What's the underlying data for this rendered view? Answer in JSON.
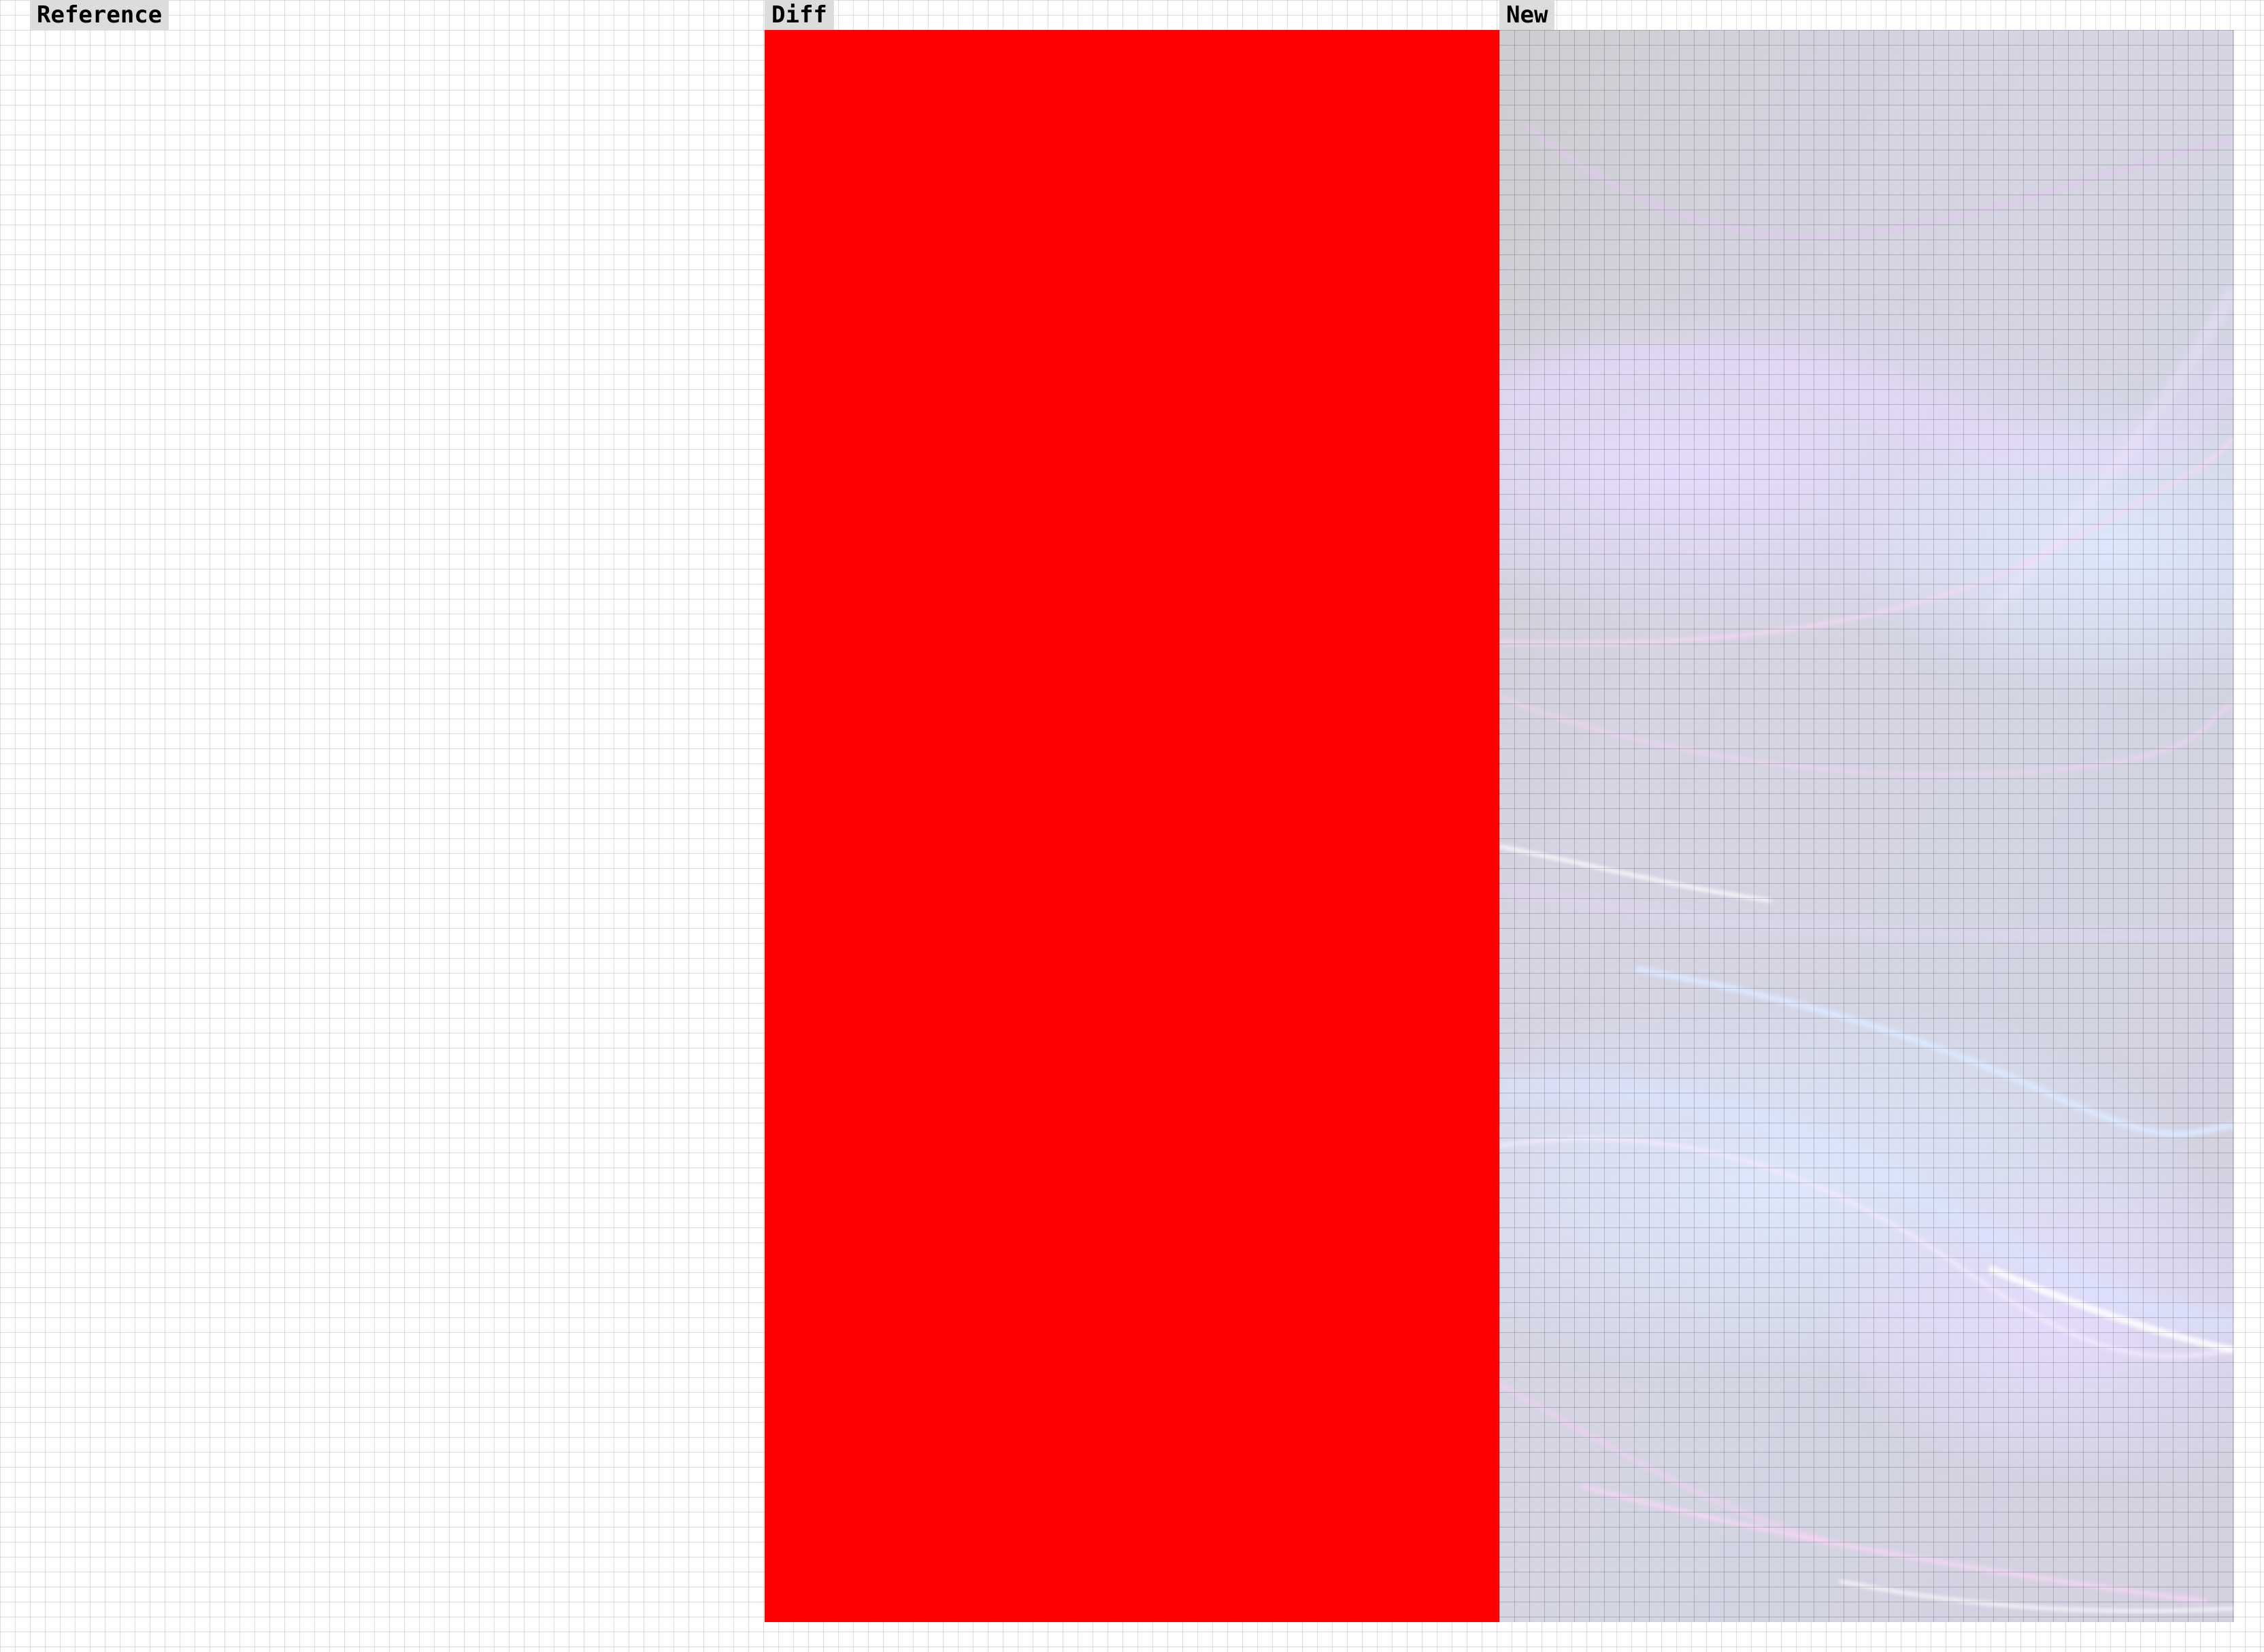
{
  "panels": {
    "reference": {
      "label": "Reference"
    },
    "diff": {
      "label": "Diff",
      "color": "#ff0000"
    },
    "new": {
      "label": "New",
      "wallpaper": "abstract-wave-wallpaper"
    }
  }
}
